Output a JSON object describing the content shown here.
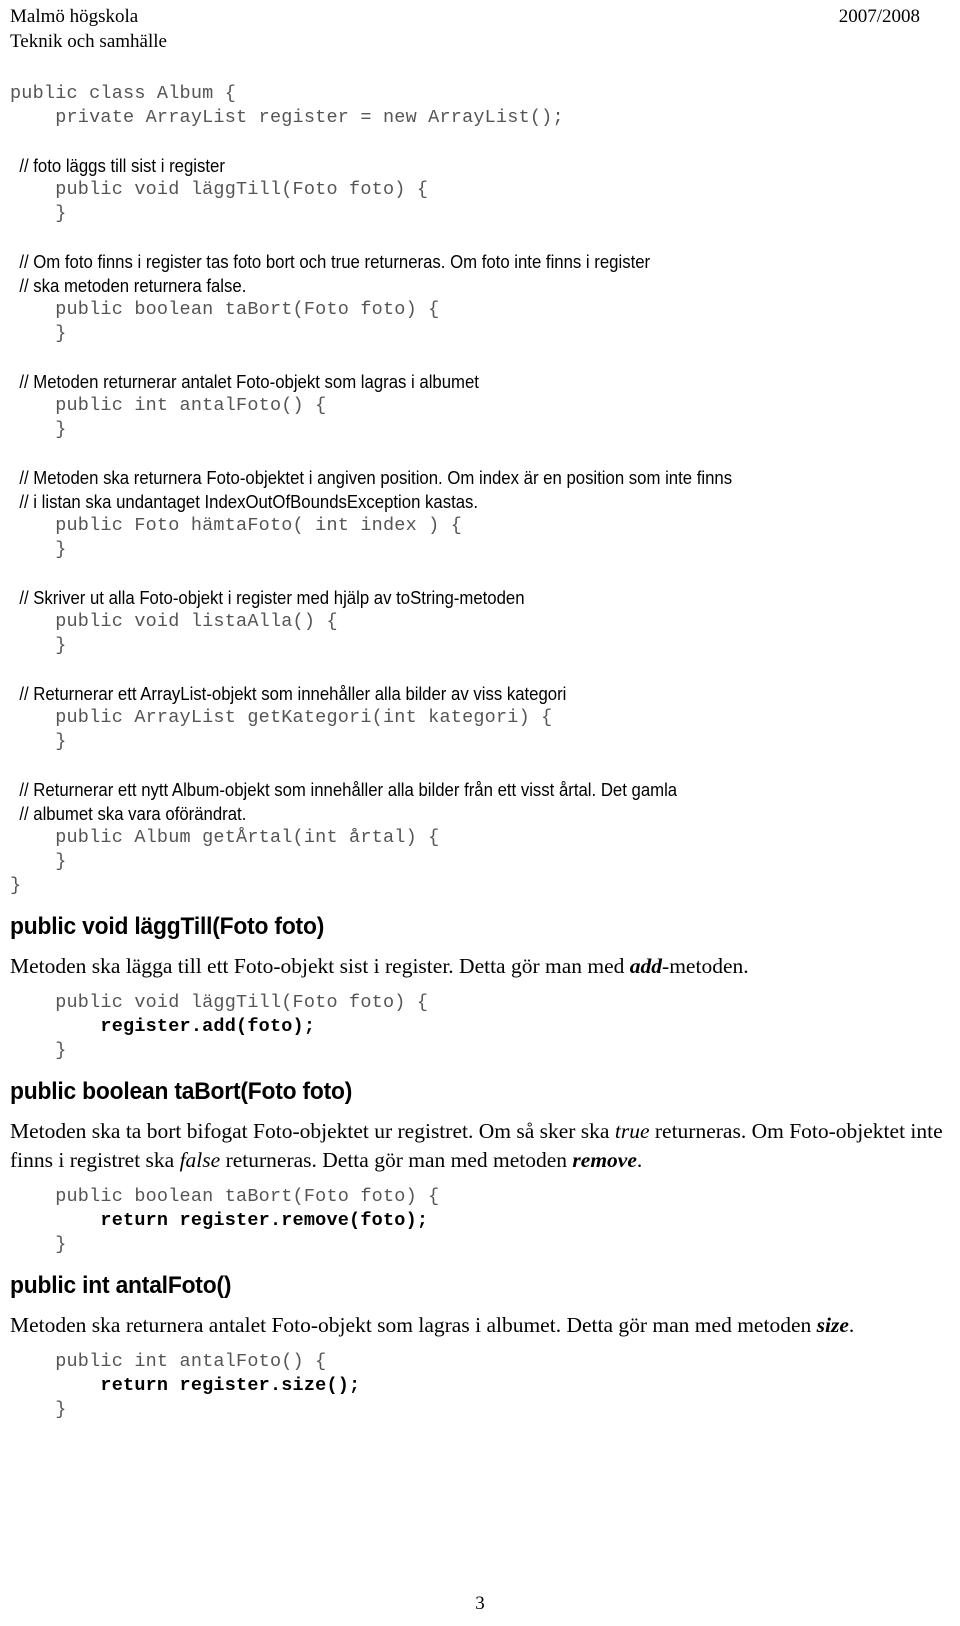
{
  "header": {
    "institution_line1": "Malmö högskola",
    "institution_line2": "Teknik och samhälle",
    "academic_year": "2007/2008"
  },
  "skeleton": {
    "lines": [
      {
        "type": "code",
        "text": "public class Album {"
      },
      {
        "type": "code",
        "text": "    private ArrayList register = new ArrayList();"
      },
      {
        "type": "blank",
        "text": ""
      },
      {
        "type": "comment",
        "text": "  // foto läggs till sist i register"
      },
      {
        "type": "code",
        "text": "    public void läggTill(Foto foto) {"
      },
      {
        "type": "code",
        "text": "    }"
      },
      {
        "type": "blank",
        "text": ""
      },
      {
        "type": "comment",
        "text": "  // Om foto finns i register tas foto bort och true returneras. Om foto inte finns i register"
      },
      {
        "type": "comment",
        "text": "  // ska metoden returnera false."
      },
      {
        "type": "code",
        "text": "    public boolean taBort(Foto foto) {"
      },
      {
        "type": "code",
        "text": "    }"
      },
      {
        "type": "blank",
        "text": ""
      },
      {
        "type": "comment",
        "text": "  // Metoden returnerar antalet Foto-objekt som lagras i albumet"
      },
      {
        "type": "code",
        "text": "    public int antalFoto() {"
      },
      {
        "type": "code",
        "text": "    }"
      },
      {
        "type": "blank",
        "text": ""
      },
      {
        "type": "comment",
        "text": "  // Metoden ska returnera Foto-objektet i angiven position. Om index är en position som inte finns"
      },
      {
        "type": "comment",
        "text": "  // i listan ska undantaget IndexOutOfBoundsException kastas."
      },
      {
        "type": "code",
        "text": "    public Foto hämtaFoto( int index ) {"
      },
      {
        "type": "code",
        "text": "    }"
      },
      {
        "type": "blank",
        "text": ""
      },
      {
        "type": "comment",
        "text": "  // Skriver ut alla Foto-objekt i register med hjälp av toString-metoden"
      },
      {
        "type": "code",
        "text": "    public void listaAlla() {"
      },
      {
        "type": "code",
        "text": "    }"
      },
      {
        "type": "blank",
        "text": ""
      },
      {
        "type": "comment",
        "text": "  // Returnerar ett ArrayList-objekt som innehåller alla bilder av viss kategori"
      },
      {
        "type": "code",
        "text": "    public ArrayList getKategori(int kategori) {"
      },
      {
        "type": "code",
        "text": "    }"
      },
      {
        "type": "blank",
        "text": ""
      },
      {
        "type": "comment",
        "text": "  // Returnerar ett nytt Album-objekt som innehåller alla bilder från ett visst årtal. Det gamla"
      },
      {
        "type": "comment",
        "text": "  // albumet ska vara oförändrat."
      },
      {
        "type": "code",
        "text": "    public Album getÅrtal(int årtal) {"
      },
      {
        "type": "code",
        "text": "    }"
      },
      {
        "type": "code",
        "text": "}"
      }
    ]
  },
  "sections": [
    {
      "heading": "public void läggTill(Foto foto)",
      "paragraph": {
        "parts": [
          {
            "style": "normal",
            "text": "Metoden ska lägga till ett Foto-objekt sist i register. Detta gör man med "
          },
          {
            "style": "bold-italic",
            "text": "add"
          },
          {
            "style": "normal",
            "text": "-metoden."
          }
        ]
      },
      "code": [
        {
          "bold": false,
          "text": "    public void läggTill(Foto foto) {"
        },
        {
          "bold": true,
          "text": "        register.add(foto);"
        },
        {
          "bold": false,
          "text": "    }"
        }
      ]
    },
    {
      "heading": "public boolean taBort(Foto foto)",
      "paragraph": {
        "parts": [
          {
            "style": "normal",
            "text": "Metoden ska ta bort bifogat Foto-objektet ur registret. Om så sker ska "
          },
          {
            "style": "italic",
            "text": "true"
          },
          {
            "style": "normal",
            "text": " returneras. Om Foto-objektet inte finns i registret ska "
          },
          {
            "style": "italic",
            "text": "false"
          },
          {
            "style": "normal",
            "text": " returneras. Detta gör man med metoden "
          },
          {
            "style": "bold-italic",
            "text": "remove"
          },
          {
            "style": "normal",
            "text": "."
          }
        ]
      },
      "code": [
        {
          "bold": false,
          "text": "    public boolean taBort(Foto foto) {"
        },
        {
          "bold": true,
          "text": "        return register.remove(foto);"
        },
        {
          "bold": false,
          "text": "    }"
        }
      ]
    },
    {
      "heading": "public int antalFoto()",
      "paragraph": {
        "parts": [
          {
            "style": "normal",
            "text": "Metoden ska returnera antalet Foto-objekt som lagras i albumet. Detta gör man med metoden "
          },
          {
            "style": "bold-italic",
            "text": "size"
          },
          {
            "style": "normal",
            "text": "."
          }
        ]
      },
      "code": [
        {
          "bold": false,
          "text": "    public int antalFoto() {"
        },
        {
          "bold": true,
          "text": "        return register.size();"
        },
        {
          "bold": false,
          "text": "    }"
        }
      ]
    }
  ],
  "footer": {
    "page_number": "3"
  }
}
